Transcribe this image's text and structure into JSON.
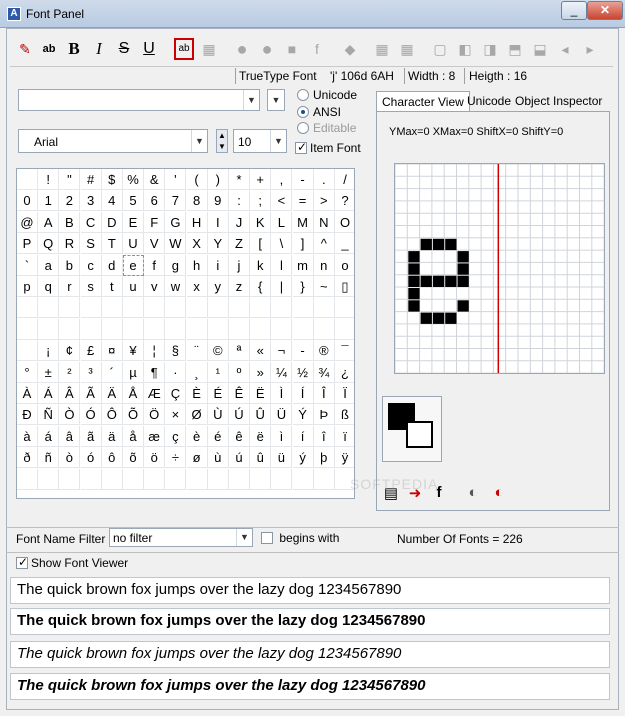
{
  "window": {
    "title": "Font Panel",
    "app_icon": "A"
  },
  "status": {
    "font_type": "TrueType Font",
    "char_info": "'j' 106d  6AH",
    "width": "Width : 8",
    "height": "Heigth : 16"
  },
  "font": {
    "name": "Arial",
    "size": "10",
    "search_value": ""
  },
  "encoding": {
    "unicode": "Unicode",
    "ansi": "ANSI",
    "editable": "Editable",
    "item_font": "Item Font"
  },
  "tabs": {
    "character_view": "Character View",
    "unicode": "Unicode",
    "object_inspector": "Object Inspector"
  },
  "metrics": "YMax=0  XMax=0  ShiftX=0  ShiftY=0",
  "filter": {
    "label": "Font Name Filter :",
    "value": "no filter",
    "begins_with": "begins with",
    "count": "Number Of Fonts = 226"
  },
  "show_viewer": "Show Font Viewer",
  "samples": {
    "regular": "The quick brown fox jumps over the lazy dog 1234567890",
    "bold": "The quick brown fox jumps over the lazy dog 1234567890",
    "italic": "The quick brown fox jumps over the lazy dog 1234567890",
    "bolditalic": "The quick brown fox jumps over the lazy dog 1234567890"
  },
  "watermark": "SOFTPEDIA",
  "icons": {
    "toolbar": [
      "pencil-icon",
      "ab-icon",
      "bold-icon",
      "italic-icon",
      "strike-icon",
      "underline-icon",
      "ab-box-icon",
      "grid-icon",
      "play-icon",
      "step-icon",
      "stop-icon",
      "f-icon",
      "erase-icon",
      "grid-a-icon",
      "grid-b-icon",
      "frame-icon",
      "nav-left-icon",
      "nav-right-icon",
      "nav-up-icon",
      "nav-down-icon",
      "prev-icon",
      "next-icon"
    ],
    "bottom": [
      "save-icon",
      "export-icon",
      "f-icon",
      "play-f-icon",
      "play-f2-icon"
    ]
  },
  "char_rows": [
    [
      " ",
      "!",
      "\"",
      "#",
      "$",
      "%",
      "&",
      "'",
      "(",
      ")",
      "*",
      "+",
      ",",
      "-",
      ".",
      "/"
    ],
    [
      "0",
      "1",
      "2",
      "3",
      "4",
      "5",
      "6",
      "7",
      "8",
      "9",
      ":",
      ";",
      "<",
      "=",
      ">",
      "?"
    ],
    [
      "@",
      "A",
      "B",
      "C",
      "D",
      "E",
      "F",
      "G",
      "H",
      "I",
      "J",
      "K",
      "L",
      "M",
      "N",
      "O"
    ],
    [
      "P",
      "Q",
      "R",
      "S",
      "T",
      "U",
      "V",
      "W",
      "X",
      "Y",
      "Z",
      "[",
      "\\",
      "]",
      "^",
      "_"
    ],
    [
      "`",
      "a",
      "b",
      "c",
      "d",
      "e",
      "f",
      "g",
      "h",
      "i",
      "j",
      "k",
      "l",
      "m",
      "n",
      "o"
    ],
    [
      "p",
      "q",
      "r",
      "s",
      "t",
      "u",
      "v",
      "w",
      "x",
      "y",
      "z",
      "{",
      "|",
      "}",
      "~",
      "▯"
    ],
    [
      "",
      "",
      "",
      "",
      "",
      "",
      "",
      "",
      "",
      "",
      "",
      "",
      "",
      "",
      "",
      ""
    ],
    [
      "",
      "",
      "",
      "",
      "",
      "",
      "",
      "",
      "",
      "",
      "",
      "",
      "",
      "",
      "",
      ""
    ],
    [
      " ",
      "¡",
      "¢",
      "£",
      "¤",
      "¥",
      "¦",
      "§",
      "¨",
      "©",
      "ª",
      "«",
      "¬",
      "-",
      "®",
      "¯"
    ],
    [
      "°",
      "±",
      "²",
      "³",
      "´",
      "µ",
      "¶",
      "·",
      "¸",
      "¹",
      "º",
      "»",
      "¼",
      "½",
      "¾",
      "¿"
    ],
    [
      "À",
      "Á",
      "Â",
      "Ã",
      "Ä",
      "Å",
      "Æ",
      "Ç",
      "È",
      "É",
      "Ê",
      "Ë",
      "Ì",
      "Í",
      "Î",
      "Ï"
    ],
    [
      "Ð",
      "Ñ",
      "Ò",
      "Ó",
      "Ô",
      "Õ",
      "Ö",
      "×",
      "Ø",
      "Ù",
      "Ú",
      "Û",
      "Ü",
      "Ý",
      "Þ",
      "ß"
    ],
    [
      "à",
      "á",
      "â",
      "ã",
      "ä",
      "å",
      "æ",
      "ç",
      "è",
      "é",
      "ê",
      "ë",
      "ì",
      "í",
      "î",
      "ï"
    ],
    [
      "ð",
      "ñ",
      "ò",
      "ó",
      "ô",
      "õ",
      "ö",
      "÷",
      "ø",
      "ù",
      "ú",
      "û",
      "ü",
      "ý",
      "þ",
      "ÿ"
    ],
    [
      "",
      "",
      "",
      "",
      "",
      "",
      "",
      "",
      "",
      "",
      "",
      "",
      "",
      "",
      "",
      ""
    ]
  ],
  "selected_char": "e"
}
